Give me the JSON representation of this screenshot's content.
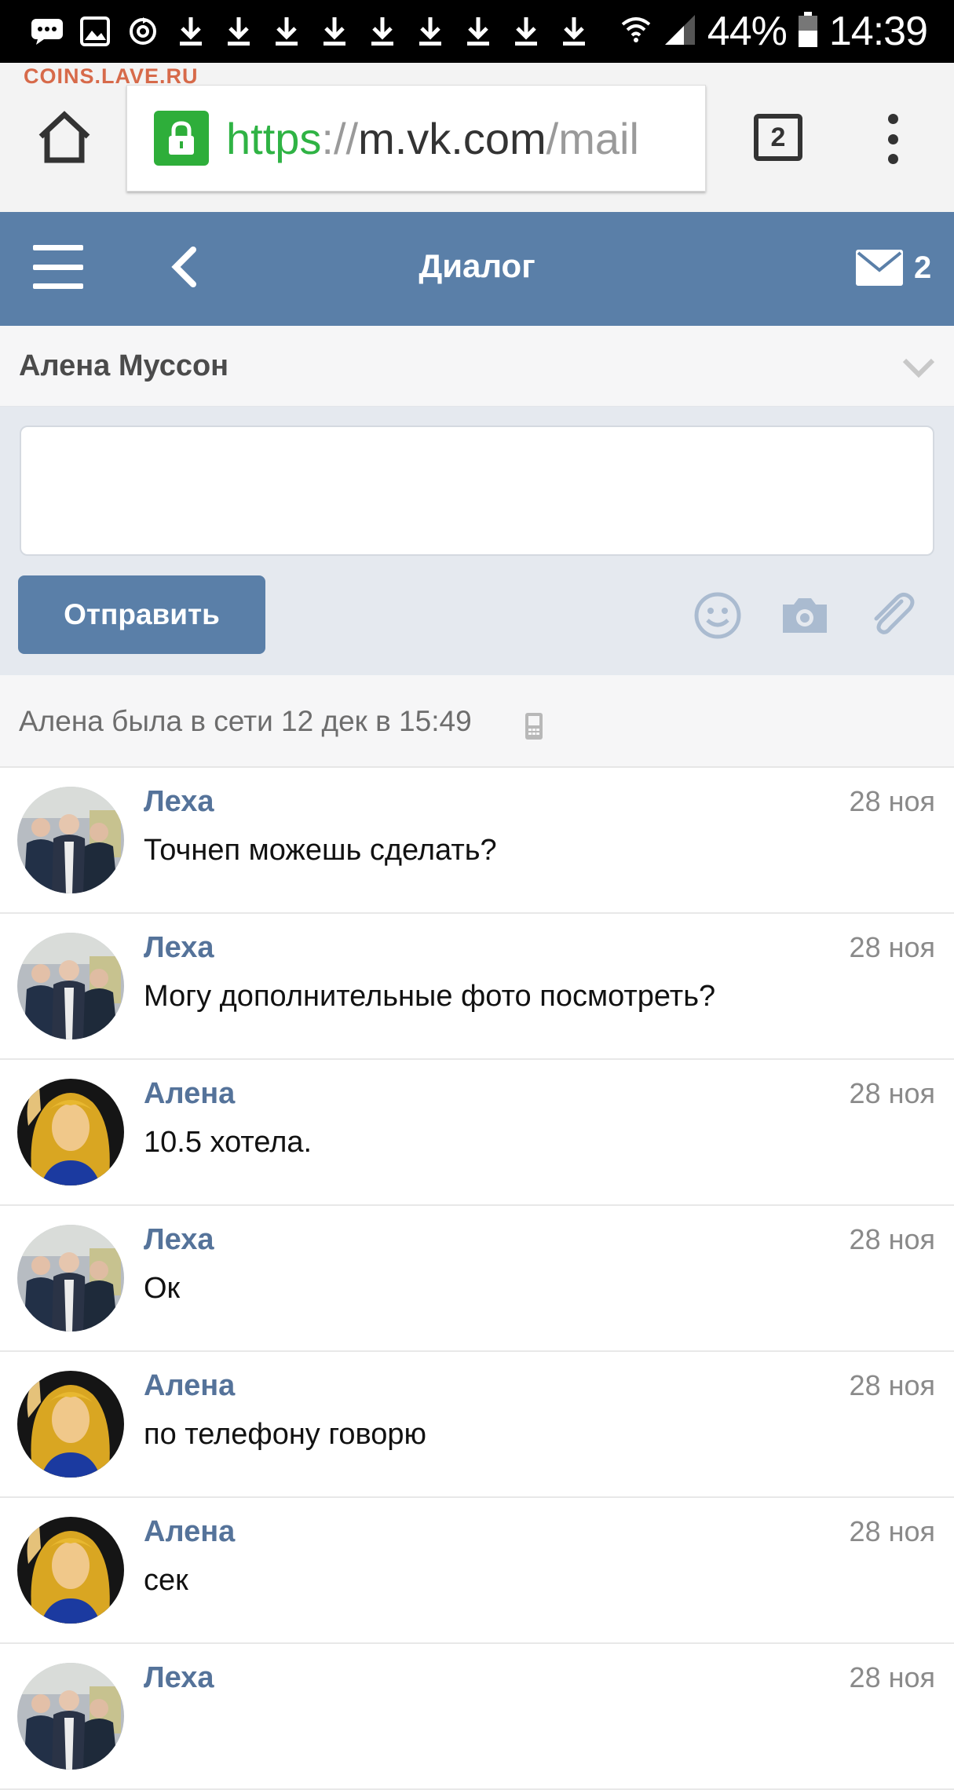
{
  "statusbar": {
    "battery": "44%",
    "time": "14:39",
    "notification_icons": [
      "message-icon",
      "image-icon",
      "sync-icon",
      "download-icon",
      "download-icon",
      "download-icon",
      "download-icon",
      "download-icon",
      "download-icon",
      "download-icon",
      "download-icon",
      "download-icon"
    ]
  },
  "browser": {
    "watermark": "COINS.LAVE.RU",
    "url_scheme": "https",
    "url_separator": "://",
    "url_host": "m.vk.com",
    "url_path": "/mail",
    "tab_count": "2"
  },
  "header": {
    "title": "Диалог",
    "mail_count": "2"
  },
  "recipient": {
    "name": "Алена Муссон"
  },
  "composer": {
    "text": "",
    "send_label": "Отправить",
    "icons": [
      "smiley-icon",
      "camera-icon",
      "paperclip-icon"
    ]
  },
  "online_status": {
    "text": "Алена была в сети 12 дек в 15:49",
    "device_icon": "mobile-phone-icon"
  },
  "messages": [
    {
      "author": "Леха",
      "date": "28 ноя",
      "text": "Точнеп можешь сделать?",
      "avatar": "group"
    },
    {
      "author": "Леха",
      "date": "28 ноя",
      "text": "Могу дополнительные фото посмотреть?",
      "avatar": "group"
    },
    {
      "author": "Алена",
      "date": "28 ноя",
      "text": "10.5 хотела.",
      "avatar": "portrait"
    },
    {
      "author": "Леха",
      "date": "28 ноя",
      "text": "Ок",
      "avatar": "group"
    },
    {
      "author": "Алена",
      "date": "28 ноя",
      "text": "по телефону говорю",
      "avatar": "portrait"
    },
    {
      "author": "Алена",
      "date": "28 ноя",
      "text": "сек",
      "avatar": "portrait"
    },
    {
      "author": "Леха",
      "date": "28 ноя",
      "text": "",
      "avatar": "group"
    }
  ],
  "colors": {
    "vk_header": "#5a7fa8",
    "author_name": "#55739a",
    "url_green": "#2fb344",
    "status_bar": "#000000"
  }
}
